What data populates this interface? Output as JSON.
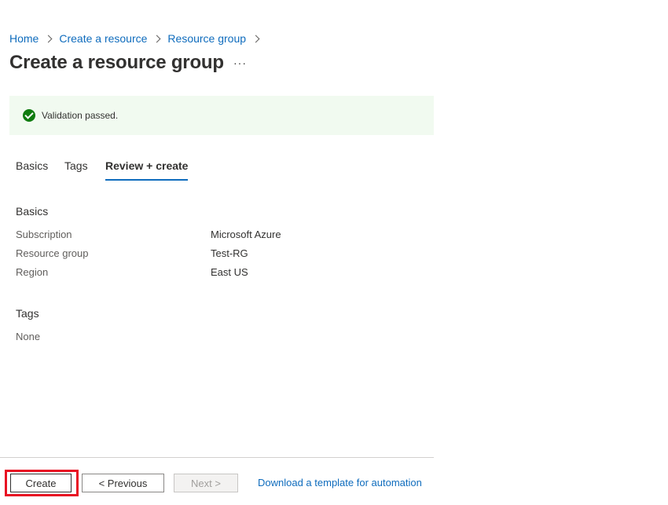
{
  "breadcrumb": {
    "items": [
      "Home",
      "Create a resource",
      "Resource group"
    ]
  },
  "page": {
    "title": "Create a resource group",
    "more_label": "···"
  },
  "banner": {
    "text": "Validation passed.",
    "status_color": "#107c10"
  },
  "tabs": [
    {
      "label": "Basics",
      "active": false
    },
    {
      "label": "Tags",
      "active": false
    },
    {
      "label": "Review + create",
      "active": true
    }
  ],
  "basics": {
    "title": "Basics",
    "rows": [
      {
        "label": "Subscription",
        "value": "Microsoft Azure"
      },
      {
        "label": "Resource group",
        "value": "Test-RG"
      },
      {
        "label": "Region",
        "value": "East US"
      }
    ]
  },
  "tags": {
    "title": "Tags",
    "value": "None"
  },
  "footer": {
    "create_label": "Create",
    "previous_label": "< Previous",
    "next_label": "Next >",
    "next_disabled": true,
    "template_link": "Download a template for automation"
  },
  "colors": {
    "accent": "#0f6cbd",
    "highlight": "#e81123",
    "banner_bg": "#f1faf0"
  }
}
